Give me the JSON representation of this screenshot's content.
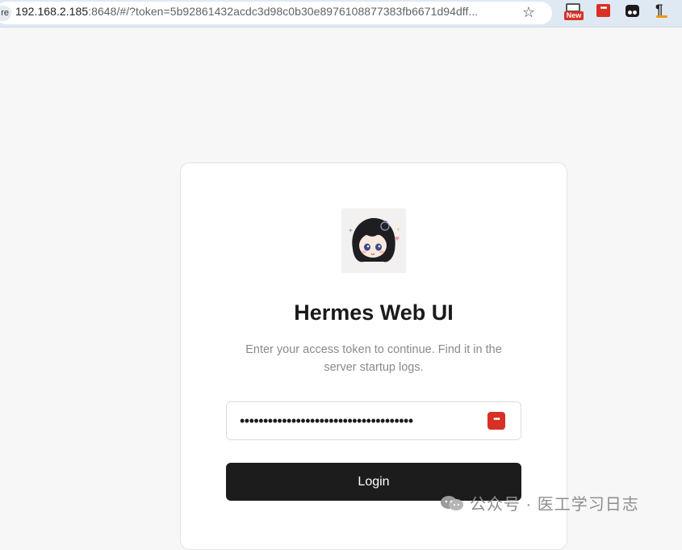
{
  "browser": {
    "site_chip": "re",
    "url_host": "192.168.2.185",
    "url_rest": ":8648/#/?token=5b92861432acdc3d98c0b30e8976108877383fb6671d94dff...",
    "ext_new_badge": "New",
    "ext_dots": "•••",
    "ext_para": "¶",
    "star": "☆"
  },
  "login": {
    "title": "Hermes Web UI",
    "subtitle": "Enter your access token to continue. Find it in the server startup logs.",
    "token_masked": "•••••••••••••••••••••••••••••••••••••",
    "password_manager_icon": "•••",
    "login_button": "Login"
  },
  "watermark": {
    "text": "公众号 · 医工学习日志"
  },
  "colors": {
    "page_bg": "#f7f7f7",
    "card_bg": "#ffffff",
    "button_bg": "#1c1c1c",
    "extension_red": "#d93025"
  }
}
